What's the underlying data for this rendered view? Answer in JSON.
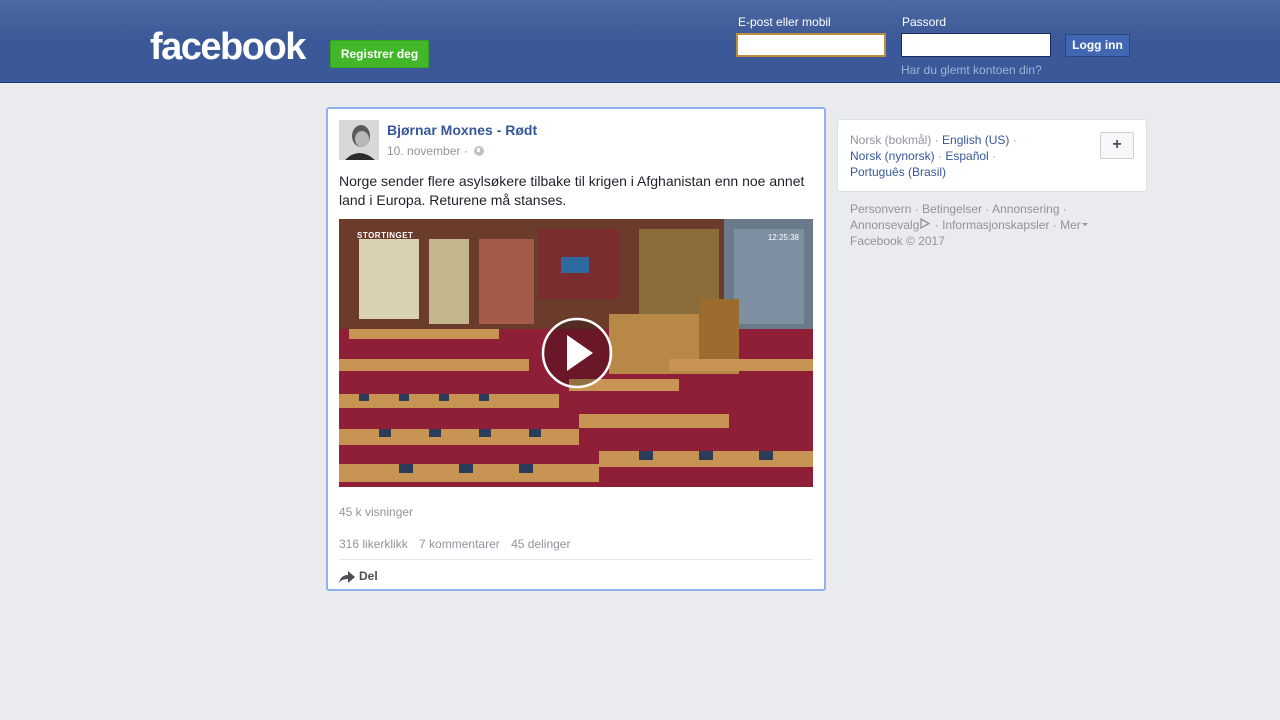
{
  "header": {
    "logo": "facebook",
    "register_label": "Registrer deg",
    "email_label": "E-post eller mobil",
    "email_value": "",
    "password_label": "Passord",
    "password_value": "",
    "login_label": "Logg inn",
    "forgot_label": "Har du glemt kontoen din?"
  },
  "post": {
    "author": "Bjørnar Moxnes - Rødt",
    "date": "10. november ·",
    "text": "Norge sender flere asylsøkere tilbake til krigen i Afghanistan enn noe annet land i Europa. Returene må stanses.",
    "video_brand": "STORTINGET",
    "video_time": "12:25:38",
    "views": "45 k visninger",
    "likes": "316 likerklikk",
    "comments": "7 kommentarer",
    "shares": "45 delinger",
    "share_label": "Del"
  },
  "languages": {
    "current": "Norsk (bokmål)",
    "items": [
      "English (US)",
      "Norsk (nynorsk)",
      "Español",
      "Português (Brasil)"
    ],
    "add_label": "+"
  },
  "footer": {
    "links": [
      "Personvern",
      "Betingelser",
      "Annonsering",
      "Annonsevalg",
      "Informasjonskapsler",
      "Mer"
    ],
    "copyright": "Facebook © 2017"
  },
  "colors": {
    "brand_blue": "#3b5998",
    "link_blue": "#365899",
    "register_green": "#42b72a",
    "page_bg": "#e9ebee"
  }
}
